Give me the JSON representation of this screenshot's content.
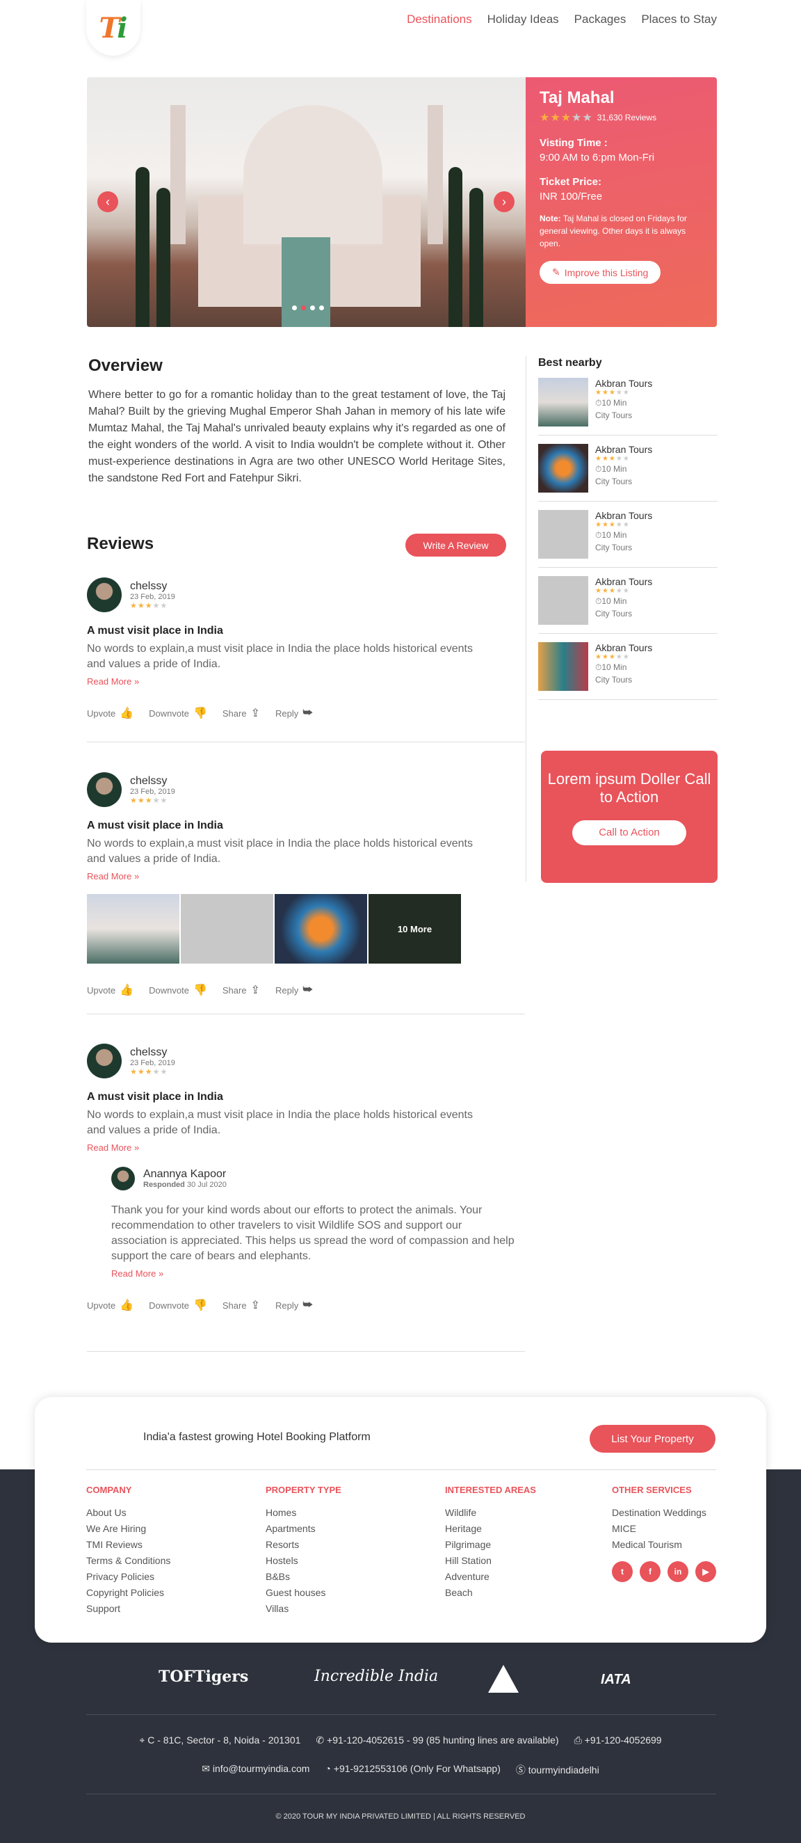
{
  "header": {
    "logo_text_a": "T",
    "logo_text_b": "i",
    "nav": [
      "Destinations",
      "Holiday Ideas",
      "Packages",
      "Places to Stay"
    ]
  },
  "hero": {
    "title": "Taj Mahal",
    "rating_stars": 3,
    "rating_count": "31,630 Reviews",
    "visiting_label": "Visting Time :",
    "visiting_value": "9:00 AM to 6:pm Mon-Fri",
    "ticket_label": "Ticket Price:",
    "ticket_value": "INR 100/Free",
    "note_label": "Note:",
    "note_text": "Taj Mahal is closed on Fridays for general viewing. Other days it is always open.",
    "improve_label": "Improve this Listing",
    "slides": 4,
    "active_slide": 2
  },
  "overview": {
    "title": "Overview",
    "text": "Where better to go for a romantic holiday than to the great testament of love, the Taj Mahal? Built by the grieving Mughal Emperor Shah Jahan in memory of his late wife Mumtaz Mahal, the Taj Mahal's unrivaled beauty explains why it's regarded as one of the eight wonders of the world. A visit to India wouldn't be complete without it. Other must-experience destinations in Agra are two other UNESCO World Heritage Sites, the sandstone Red Fort and Fatehpur Sikri."
  },
  "reviews": {
    "title": "Reviews",
    "write_label": "Write A Review",
    "read_more": "Read More",
    "actions": {
      "upvote": "Upvote",
      "downvote": "Downvote",
      "share": "Share",
      "reply": "Reply"
    },
    "items": [
      {
        "name": "chelssy",
        "date": "23 Feb, 2019",
        "stars": 3,
        "title": "A must visit place in India",
        "text": "No words to explain,a must visit place in India the place holds historical events and values a pride of India."
      },
      {
        "name": "chelssy",
        "date": "23 Feb, 2019",
        "stars": 3,
        "title": "A must visit place in India",
        "text": "No words to explain,a must visit place in India the place holds historical events and values a pride of India.",
        "more_photos": "10 More"
      },
      {
        "name": "chelssy",
        "date": "23 Feb, 2019",
        "stars": 3,
        "title": "A must visit place in India",
        "text": "No words to explain,a must visit place in India the place holds historical events and values a pride of India."
      }
    ],
    "reply": {
      "name": "Anannya Kapoor",
      "responded_label": "Responded",
      "date": "30 Jul 2020",
      "text": "Thank you for your kind words about our efforts to protect the animals. Your recommendation to other travelers to visit Wildlife SOS and support our association is appreciated. This helps us spread the word of compassion and help support the care of bears and elephants."
    }
  },
  "sidebar": {
    "title": "Best nearby",
    "items": [
      {
        "name": "Akbran Tours",
        "stars": 3,
        "time": "10 Min",
        "type": "City Tours"
      },
      {
        "name": "Akbran Tours",
        "stars": 3,
        "time": "10 Min",
        "type": "City Tours"
      },
      {
        "name": "Akbran Tours",
        "stars": 3,
        "time": "10 Min",
        "type": "City Tours"
      },
      {
        "name": "Akbran Tours",
        "stars": 3,
        "time": "10 Min",
        "type": "City Tours"
      },
      {
        "name": "Akbran Tours",
        "stars": 3,
        "time": "10 Min",
        "type": "City Tours"
      }
    ],
    "cta_text": "Lorem ipsum Doller Call to Action",
    "cta_button": "Call to Action"
  },
  "footer": {
    "tagline": "India'a fastest growing Hotel Booking Platform",
    "list_property": "List Your Property",
    "columns": [
      {
        "title": "COMPANY",
        "items": [
          "About Us",
          "We Are Hiring",
          "TMI Reviews",
          "Terms & Conditions",
          "Privacy Policies",
          "Copyright Policies",
          "Support"
        ]
      },
      {
        "title": "PROPERTY TYPE",
        "items": [
          "Homes",
          "Apartments",
          "Resorts",
          "Hostels",
          "B&Bs",
          "Guest houses",
          "Villas"
        ]
      },
      {
        "title": "INTERESTED AREAS",
        "items": [
          "Wildlife",
          "Heritage",
          "Pilgrimage",
          "Hill Station",
          "Adventure",
          "Beach"
        ]
      },
      {
        "title": "OTHER SERVICES",
        "items": [
          "Destination Weddings",
          "MICE",
          "Medical Tourism"
        ]
      }
    ],
    "logos": {
      "toftigers": "TOFTigers",
      "incredible": "Incredible India",
      "iata": "IATA"
    },
    "address": "C - 81C, Sector - 8, Noida - 201301",
    "phone": "+91-120-4052615 - 99 (85 hunting lines are available)",
    "fax": "+91-120-4052699",
    "email": "info@tourmyindia.com",
    "whatsapp": "+91-9212553106 (Only For Whatsapp)",
    "skype": "tourmyindiadelhi",
    "copyright": "© 2020 TOUR MY INDIA PRIVATED LIMITED | ALL RIGHTS RESERVED"
  }
}
